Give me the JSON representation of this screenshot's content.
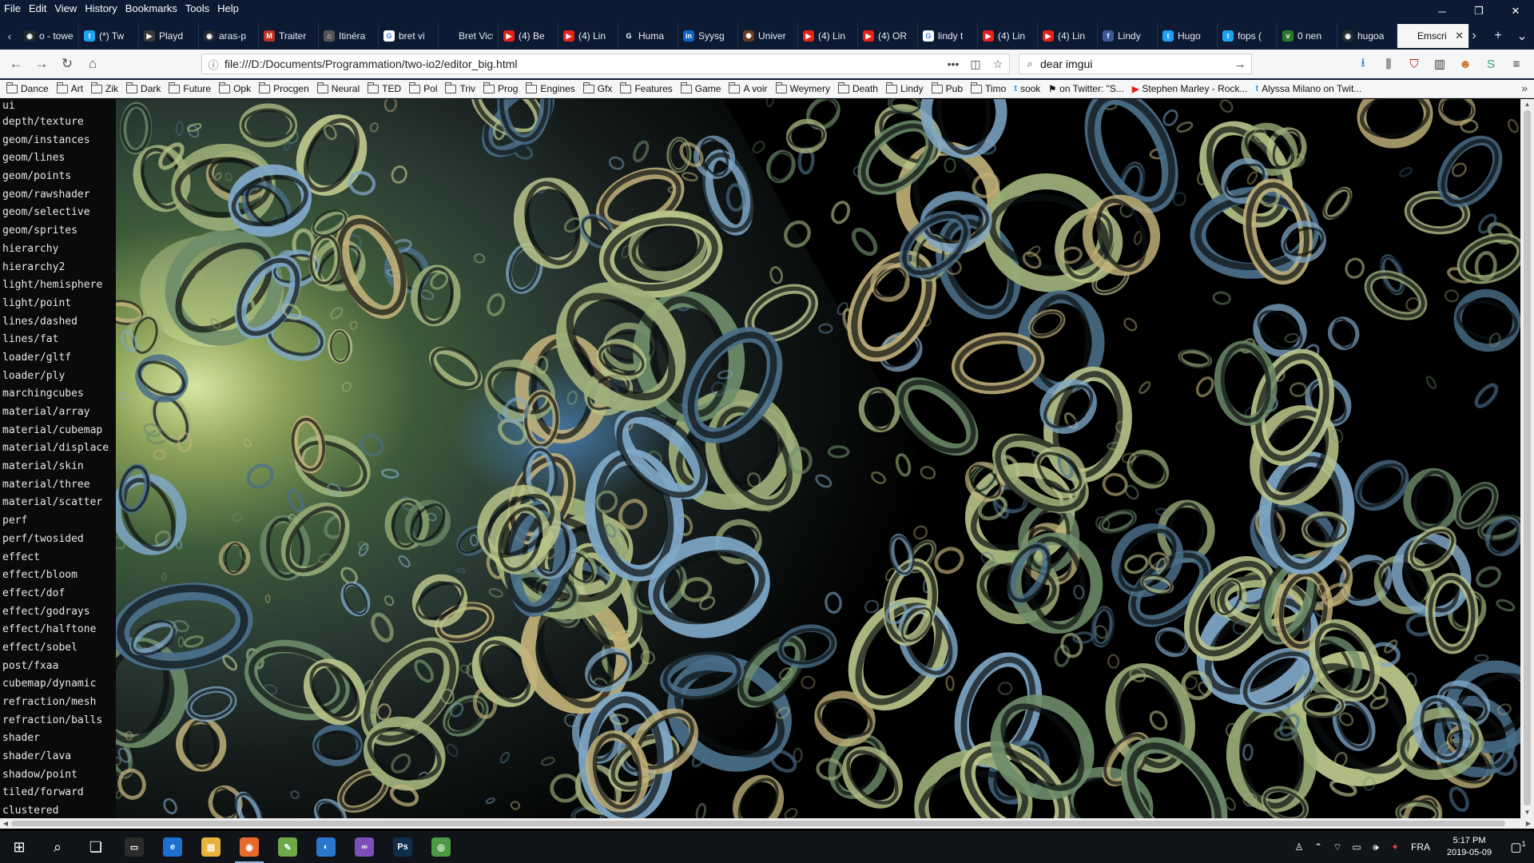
{
  "menubar": [
    "File",
    "Edit",
    "View",
    "History",
    "Bookmarks",
    "Tools",
    "Help"
  ],
  "window_controls": {
    "minimize": "─",
    "restore": "❐",
    "close": "✕"
  },
  "tabs": [
    {
      "label": "o - towe",
      "icon": "github-icon",
      "color": "#24292e",
      "glyph": "◉"
    },
    {
      "label": "(*) Tw",
      "icon": "twitter-icon",
      "color": "#1da1f2",
      "glyph": "t"
    },
    {
      "label": "Playd",
      "icon": "play-icon",
      "color": "#3a3a3a",
      "glyph": "▶"
    },
    {
      "label": "aras-p",
      "icon": "github-icon",
      "color": "#24292e",
      "glyph": "◉"
    },
    {
      "label": "Traiter",
      "icon": "gmail-icon",
      "color": "#c23321",
      "glyph": "M"
    },
    {
      "label": "Itinéra",
      "icon": "route-icon",
      "color": "#555",
      "glyph": "⌂"
    },
    {
      "label": "bret vi",
      "icon": "google-icon",
      "color": "#ffffff",
      "glyph": "G"
    },
    {
      "label": "Bret Victo",
      "icon": "page-icon",
      "color": "#0c1a33",
      "glyph": ""
    },
    {
      "label": "(4) Be",
      "icon": "youtube-icon",
      "color": "#e62117",
      "glyph": "▶"
    },
    {
      "label": "(4) Lin",
      "icon": "youtube-icon",
      "color": "#e62117",
      "glyph": "▶"
    },
    {
      "label": "Huma",
      "icon": "g-icon",
      "color": "#0c1a33",
      "glyph": "G"
    },
    {
      "label": "Syysg",
      "icon": "linkedin-icon",
      "color": "#0a66c2",
      "glyph": "in"
    },
    {
      "label": "Univer",
      "icon": "sun-icon",
      "color": "#6b3a1d",
      "glyph": "✺"
    },
    {
      "label": "(4) Lin",
      "icon": "youtube-icon",
      "color": "#e62117",
      "glyph": "▶"
    },
    {
      "label": "(4) OR",
      "icon": "youtube-icon",
      "color": "#e62117",
      "glyph": "▶"
    },
    {
      "label": "lindy t",
      "icon": "google-icon",
      "color": "#ffffff",
      "glyph": "G"
    },
    {
      "label": "(4) Lin",
      "icon": "youtube-icon",
      "color": "#e62117",
      "glyph": "▶"
    },
    {
      "label": "(4) Lin",
      "icon": "youtube-icon",
      "color": "#e62117",
      "glyph": "▶"
    },
    {
      "label": "Lindy",
      "icon": "facebook-icon",
      "color": "#3b5998",
      "glyph": "f"
    },
    {
      "label": "Hugo",
      "icon": "twitter-icon",
      "color": "#1da1f2",
      "glyph": "t"
    },
    {
      "label": "fops (",
      "icon": "twitter-icon",
      "color": "#1da1f2",
      "glyph": "t"
    },
    {
      "label": "0 nen",
      "icon": "vine-icon",
      "color": "#2b7a2b",
      "glyph": "v"
    },
    {
      "label": "hugoa",
      "icon": "github-icon",
      "color": "#24292e",
      "glyph": "◉"
    },
    {
      "label": "Emscri",
      "icon": "page-icon",
      "color": "#f6f6f6",
      "glyph": "",
      "active": true
    }
  ],
  "tab_close": "✕",
  "url": "file:///D:/Documents/Programmation/two-io2/editor_big.html",
  "search": {
    "value": "dear imgui"
  },
  "bookmarks": [
    {
      "label": "Dance",
      "type": "folder"
    },
    {
      "label": "Art",
      "type": "folder"
    },
    {
      "label": "Zik",
      "type": "folder"
    },
    {
      "label": "Dark",
      "type": "folder"
    },
    {
      "label": "Future",
      "type": "folder"
    },
    {
      "label": "Opk",
      "type": "folder"
    },
    {
      "label": "Procgen",
      "type": "folder"
    },
    {
      "label": "Neural",
      "type": "folder"
    },
    {
      "label": "TED",
      "type": "folder"
    },
    {
      "label": "Pol",
      "type": "folder"
    },
    {
      "label": "Triv",
      "type": "folder"
    },
    {
      "label": "Prog",
      "type": "folder"
    },
    {
      "label": "Engines",
      "type": "folder"
    },
    {
      "label": "Gfx",
      "type": "folder"
    },
    {
      "label": "Features",
      "type": "folder"
    },
    {
      "label": "Game",
      "type": "folder"
    },
    {
      "label": "A voir",
      "type": "folder"
    },
    {
      "label": "Weymery",
      "type": "folder"
    },
    {
      "label": "Death",
      "type": "folder"
    },
    {
      "label": "Lindy",
      "type": "folder"
    },
    {
      "label": "Pub",
      "type": "folder"
    },
    {
      "label": "Timo",
      "type": "folder"
    },
    {
      "label": "sook",
      "type": "twitter"
    },
    {
      "label": "on Twitter: \"S...",
      "type": "flag"
    },
    {
      "label": "Stephen Marley - Rock...",
      "type": "youtube"
    },
    {
      "label": "Alyssa Milano on Twit...",
      "type": "twitter"
    }
  ],
  "sidebar": [
    "ui",
    "depth/texture",
    "geom/instances",
    "geom/lines",
    "geom/points",
    "geom/rawshader",
    "geom/selective",
    "geom/sprites",
    "hierarchy",
    "hierarchy2",
    "light/hemisphere",
    "light/point",
    "lines/dashed",
    "lines/fat",
    "loader/gltf",
    "loader/ply",
    "marchingcubes",
    "material/array",
    "material/cubemap",
    "material/displace",
    "material/skin",
    "material/three",
    "material/scatter",
    "perf",
    "perf/twosided",
    "effect",
    "effect/bloom",
    "effect/dof",
    "effect/godrays",
    "effect/halftone",
    "effect/sobel",
    "post/fxaa",
    "cubemap/dynamic",
    "refraction/mesh",
    "refraction/balls",
    "shader",
    "shader/lava",
    "shadow/point",
    "tiled/forward",
    "clustered"
  ],
  "taskbar": {
    "apps": [
      {
        "name": "cmd-icon",
        "glyph": "▭",
        "color": "#2b2b2b"
      },
      {
        "name": "edge-icon",
        "glyph": "e",
        "color": "#1f6fd1"
      },
      {
        "name": "explorer-icon",
        "glyph": "▤",
        "color": "#e8b33c"
      },
      {
        "name": "firefox-icon",
        "glyph": "◉",
        "color": "#e76a2c",
        "open": true
      },
      {
        "name": "notepadpp-icon",
        "glyph": "✎",
        "color": "#6fa84a"
      },
      {
        "name": "outlook-icon",
        "glyph": "◐",
        "color": "#2a76cf"
      },
      {
        "name": "visual-studio-icon",
        "glyph": "∞",
        "color": "#7b4fb5"
      },
      {
        "name": "photoshop-icon",
        "glyph": "Ps",
        "color": "#0d2f4c"
      },
      {
        "name": "chrome-icon",
        "glyph": "◎",
        "color": "#4c9b44"
      }
    ],
    "language": "FRA",
    "time": "5:17 PM",
    "date": "2019-05-09",
    "notifications": "1"
  }
}
